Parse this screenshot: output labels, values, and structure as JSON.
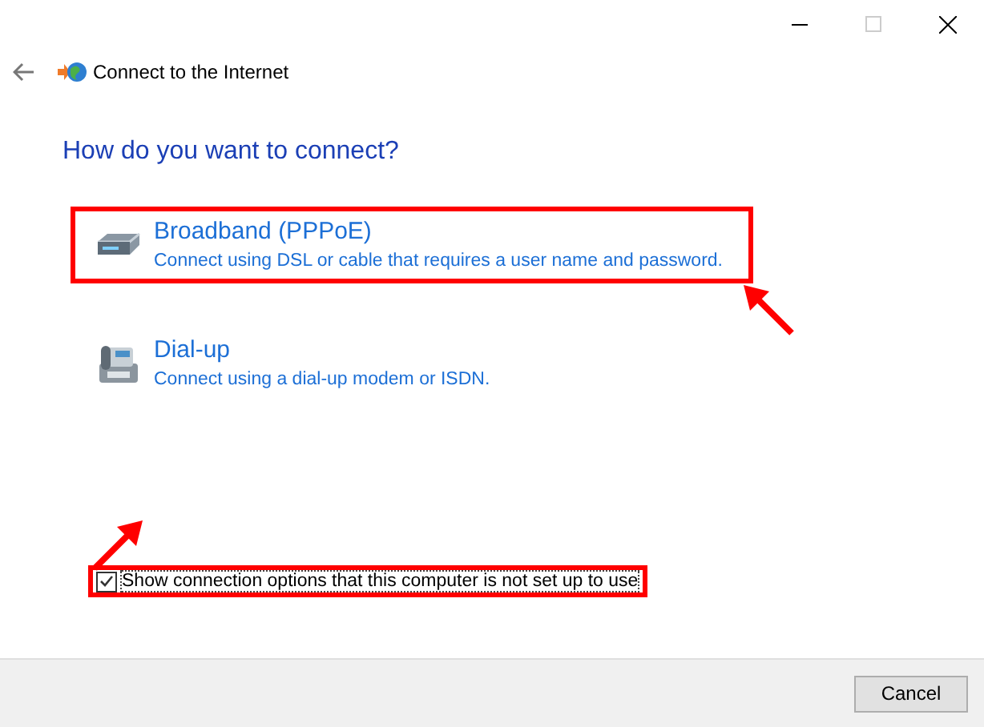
{
  "window": {
    "title": "Connect to the Internet"
  },
  "heading": "How do you want to connect?",
  "options": [
    {
      "kind": "broadband",
      "title": "Broadband (PPPoE)",
      "description": "Connect using DSL or cable that requires a user name and password.",
      "highlighted": true
    },
    {
      "kind": "dialup",
      "title": "Dial-up",
      "description": "Connect using a dial-up modem or ISDN.",
      "highlighted": false
    }
  ],
  "show_all": {
    "label": "Show connection options that this computer is not set up to use",
    "checked": true,
    "highlighted": true
  },
  "buttons": [
    "Cancel"
  ]
}
